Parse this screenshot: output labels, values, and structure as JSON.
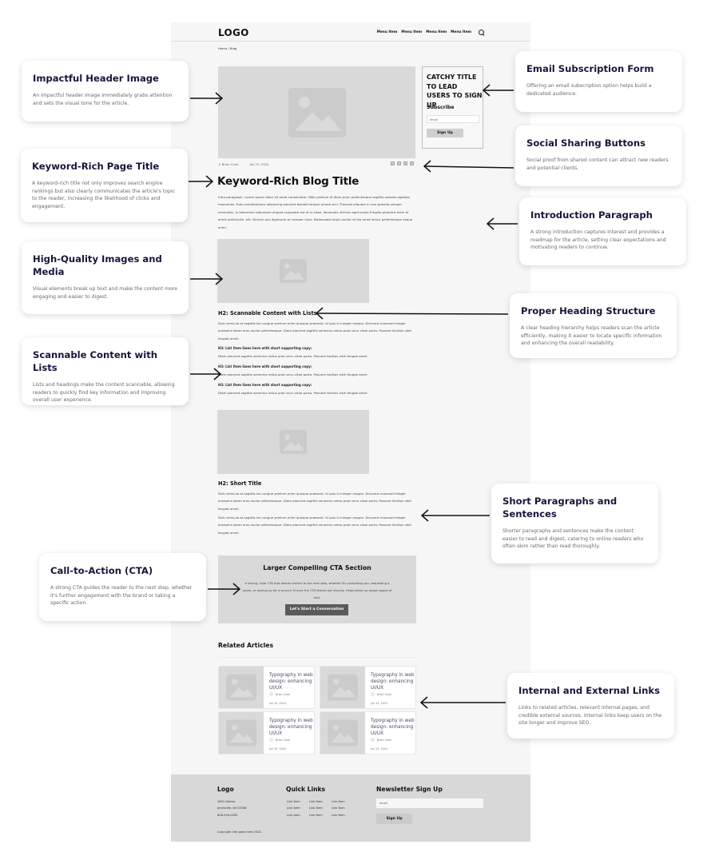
{
  "wireframe": {
    "header": {
      "logo": "LOGO",
      "menu_items": [
        "Menu Item",
        "Menu Item",
        "Menu Item",
        "Menu Item"
      ],
      "search_icon": "search-icon"
    },
    "breadcrumb": "Home / Blog",
    "signup_box": {
      "title": "CATCHY TITLE TO LEAD USERS TO SIGN UP",
      "subscribe_label": "Subscribe",
      "email_placeholder": "email",
      "button": "Sign Up"
    },
    "meta": {
      "author": "Brian Clark",
      "date": "Jan 15, 2024"
    },
    "social_icons": [
      "facebook-icon",
      "twitter-icon",
      "linkedin-icon",
      "share-icon"
    ],
    "title": "Keyword-Rich Blog Title",
    "intro": "Intro paragraph. Lorem ipsum dolor sit amet consectetur. Nibh pretium at diam proin pellentesque sagittis sodales egestas maecenas. Duis condimentum adipiscing placerat blandit tempor ornare orci. Placerat aliquam in non gravida semper venenatis. In bibendum bibendum aliquet vulputate est id in vitae. Venenatis ultrices eget turpis fringilla pharetra enim et amet sollicitudin, elit. Dictum orci dignissim ac semper risus. Malesuada turpis auctor et leo amet lectus pellentesque neque enim.",
    "section1": {
      "heading": "H2: Scannable Content with Lists",
      "body": "Duis vehicula at sagittis leo congue pretium enim quisque praesent. Id quis in integer magna. Dictumst euismod integer praesent etiam eros auctor pellentesque. Diam placerat sagittis senectus netus proin arcu vitae porta. Posuere facilisis nibh feugiat amet .",
      "list_items": [
        {
          "heading": "H3: List Item Goes here with short supporting copy:",
          "text": "Diam placerat sagittis senectus netus proin arcu vitae porta. Posuere facilisis nibh feugiat amet"
        },
        {
          "heading": "H3: List Item Goes here with short supporting copy:",
          "text": "Diam placerat sagittis senectus netus proin arcu vitae porta. Posuere facilisis nibh feugiat amet"
        },
        {
          "heading": "H3: List Item Goes here with short supporting copy:",
          "text": "Diam placerat sagittis senectus netus proin arcu vitae porta. Posuere facilisis nibh feugiat amet"
        }
      ]
    },
    "section2": {
      "heading": "H2: Short Title",
      "paragraphs": [
        "Duis vehicula at sagittis leo congue pretium enim quisque praesent. Id quis in integer magna. Dictumst euismod integer praesent etiam eros auctor pellentesque. Diam placerat sagittis senectus netus proin arcu vitae porta. Posuere facilisis nibh feugiat amet .",
        "Duis vehicula at sagittis leo congue pretium enim quisque praesent. Id quis in integer magna. Dictumst euismod integer praesent etiam eros auctor pellentesque. Diam placerat sagittis senectus netus proin arcu vitae porta. Posuere facilisis nibh feugiat amet ."
      ]
    },
    "cta": {
      "title": "Larger Compelling CTA Section",
      "description": "A strong, clear CTA that directs visitors to the next step, whether it's contacting you, requesting a quote, or signing up for a service. Ensure the CTA stands out visually. Helps break up longer pages of text.",
      "button": "Let's Start a Conversation"
    },
    "related": {
      "title": "Related Articles",
      "articles": [
        {
          "title": "Typography in web design: enhancing UI/UX",
          "author": "Brian Clark",
          "date": "Jun 24, 2024"
        },
        {
          "title": "Typography in web design: enhancing UI/UX",
          "author": "Brian Clark",
          "date": "Jun 24, 2024"
        },
        {
          "title": "Typography in web design: enhancing UI/UX",
          "author": "Brian Clark",
          "date": "Jun 24, 2024"
        },
        {
          "title": "Typography in web design: enhancing UI/UX",
          "author": "Brian Clark",
          "date": "Jun 24, 2024"
        }
      ]
    },
    "footer": {
      "logo": "Logo",
      "address": [
        "1801 Adress",
        "Janesville, WI 53546",
        "608-000-0000"
      ],
      "quick_links_title": "Quick Links",
      "link_label": "Link Item",
      "newsletter_title": "Newsletter Sign Up",
      "email_placeholder": "email",
      "button": "Sign Up",
      "copyright": "Copyright info goes here 2024."
    }
  },
  "annotations": {
    "left": [
      {
        "title": "Impactful Header Image",
        "desc": "An impactful header image immediately grabs attention and sets the visual tone for the article."
      },
      {
        "title": "Keyword-Rich Page Title",
        "desc": "A keyword-rich title not only improves search engine rankings but also clearly communicates the article's topic to the reader, increasing the likelihood of clicks and engagement."
      },
      {
        "title": "High-Quality Images and Media",
        "desc": "Visual elements break up text and make the content more engaging and easier to digest."
      },
      {
        "title": "Scannable Content with Lists",
        "desc": "Lists and headings make the content scannable, allowing readers to quickly find key information and improving overall user experience."
      },
      {
        "title": "Call-to-Action (CTA)",
        "desc": "A strong CTA guides the reader to the next step, whether it's further engagement with the brand or taking a specific action."
      }
    ],
    "right": [
      {
        "title": "Email Subscription Form",
        "desc": "Offering an email subscription option helps build a dedicated audience."
      },
      {
        "title": "Social Sharing Buttons",
        "desc": "Social proof from shared content can attract new readers and potential clients."
      },
      {
        "title": "Introduction Paragraph",
        "desc": "A strong introduction captures interest and provides a roadmap for the article, setting clear expectations and motivating readers to continue."
      },
      {
        "title": "Proper Heading Structure",
        "desc": "A clear heading hierarchy helps readers scan the article efficiently, making it easier to locate specific information and enhancing the overall readability."
      },
      {
        "title": "Short Paragraphs and Sentences",
        "desc": "Shorter paragraphs and sentences make the content easier to read and digest, catering to online readers who often skim rather than read thoroughly."
      },
      {
        "title": "Internal and External Links",
        "desc": "Links to related articles, relevant internal pages, and credible external sources. Internal links keep users on the site longer and improve SEO."
      }
    ]
  }
}
